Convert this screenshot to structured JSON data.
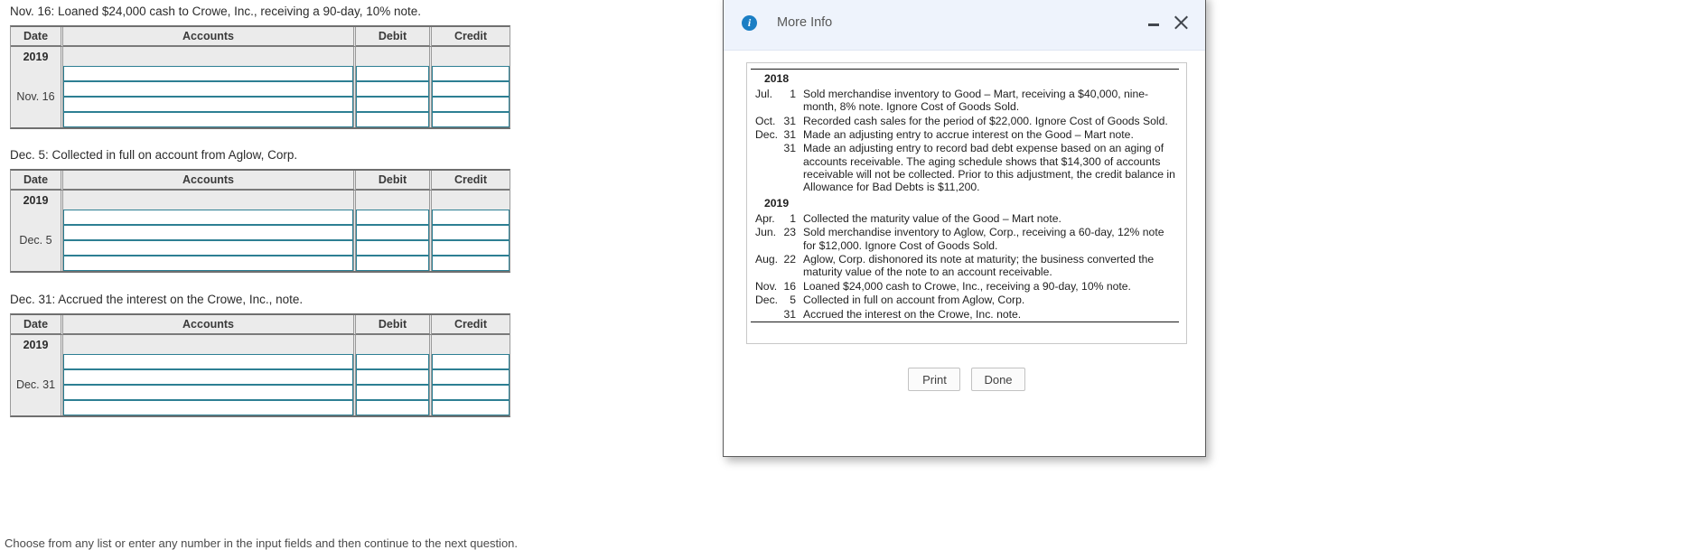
{
  "worksheet": {
    "columns": [
      "Date",
      "Accounts",
      "Debit",
      "Credit"
    ],
    "footnote": "Choose from any list or enter any number in the input fields and then continue to the next question.",
    "entries": [
      {
        "prompt": "Nov. 16: Loaned $24,000 cash to Crowe, Inc., receiving a 90-day, 10% note.",
        "year": "2019",
        "date": "Nov. 16",
        "rows": 4
      },
      {
        "prompt": "Dec. 5: Collected in full on account from Aglow, Corp.",
        "year": "2019",
        "date": "Dec. 5",
        "rows": 4
      },
      {
        "prompt": "Dec. 31: Accrued the interest on the Crowe, Inc., note.",
        "year": "2019",
        "date": "Dec. 31",
        "rows": 4
      }
    ]
  },
  "dialog": {
    "title": "More Info",
    "info_icon": "info-icon",
    "minimize_icon": "minimize-icon",
    "close_icon": "close-icon",
    "buttons": {
      "print": "Print",
      "done": "Done"
    },
    "transactions": [
      {
        "type": "year",
        "label": "2018"
      },
      {
        "month": "Jul.",
        "day": "1",
        "desc": "Sold merchandise inventory to Good – Mart, receiving a $40,000, nine-month, 8% note. Ignore Cost of Goods Sold."
      },
      {
        "month": "Oct.",
        "day": "31",
        "desc": "Recorded cash sales for the period of $22,000. Ignore Cost of Goods Sold."
      },
      {
        "month": "Dec.",
        "day": "31",
        "desc": "Made an adjusting entry to accrue interest on the Good – Mart note."
      },
      {
        "month": "",
        "day": "31",
        "desc": "Made an adjusting entry to record bad debt expense based on an aging of accounts receivable. The aging schedule shows that $14,300 of accounts receivable will not be collected. Prior to this adjustment, the credit balance in Allowance for Bad Debts is $11,200."
      },
      {
        "type": "year",
        "label": "2019"
      },
      {
        "month": "Apr.",
        "day": "1",
        "desc": "Collected the maturity value of the Good – Mart note."
      },
      {
        "month": "Jun.",
        "day": "23",
        "desc": "Sold merchandise inventory to Aglow, Corp., receiving a 60-day, 12% note for $12,000. Ignore Cost of Goods Sold."
      },
      {
        "month": "Aug.",
        "day": "22",
        "desc": "Aglow, Corp. dishonored its note at maturity; the business converted the maturity value of the note to an account receivable."
      },
      {
        "month": "Nov.",
        "day": "16",
        "desc": "Loaned $24,000 cash to Crowe, Inc., receiving a 90-day, 10% note."
      },
      {
        "month": "Dec.",
        "day": "5",
        "desc": "Collected in full on account from Aglow, Corp."
      },
      {
        "month": "",
        "day": "31",
        "desc": "Accrued the interest on the Crowe, Inc. note."
      }
    ]
  },
  "colors": {
    "accent": "#1b7ec4",
    "input_border": "#2d7f93",
    "header_bg": "#ebebeb",
    "dialog_header_bg": "#eef3fc"
  }
}
